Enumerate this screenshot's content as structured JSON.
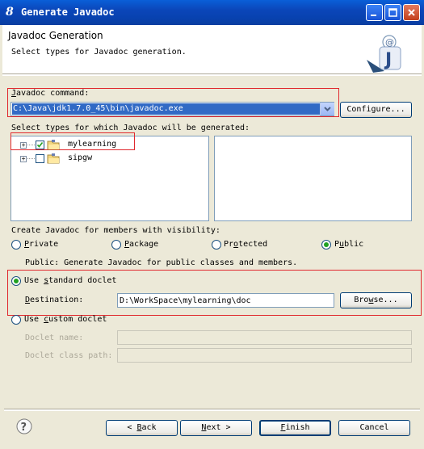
{
  "window": {
    "title": "Generate Javadoc",
    "app_icon": "8"
  },
  "header": {
    "heading": "Javadoc Generation",
    "description": "Select types for Javadoc generation."
  },
  "javadoc_command": {
    "label_mnemonic": "J",
    "label_rest": "avadoc command:",
    "value": "C:\\Java\\jdk1.7.0_45\\bin\\javadoc.exe",
    "configure_label": "Configure..."
  },
  "types": {
    "label": "Select types for which Javadoc will be generated:",
    "items": [
      {
        "name": "mylearning",
        "checked": true
      },
      {
        "name": "sipgw",
        "checked": false
      }
    ]
  },
  "visibility": {
    "label": "Create Javadoc for members with visibility:",
    "options": [
      {
        "m": "",
        "label": "Private",
        "pre": "",
        "rest": "Private",
        "selected": false
      },
      {
        "pre": "",
        "m": "P",
        "rest": "ackage",
        "selected": false
      },
      {
        "pre": "Pr",
        "m": "o",
        "rest": "tected",
        "selected": false
      },
      {
        "pre": "P",
        "m": "u",
        "rest": "blic",
        "selected": true
      }
    ],
    "description": "Public: Generate Javadoc for public classes and members."
  },
  "standard_doclet": {
    "pre": "Use ",
    "m": "s",
    "rest": "tandard doclet",
    "selected": true,
    "destination_pre": "",
    "destination_m": "D",
    "destination_rest": "estination:",
    "destination_value": "D:\\WorkSpace\\mylearning\\doc",
    "browse_pre": "Bro",
    "browse_m": "w",
    "browse_rest": "se..."
  },
  "custom_doclet": {
    "pre": "Use ",
    "m": "c",
    "rest": "ustom doclet",
    "selected": false,
    "name_label": "Doclet name:",
    "classpath_label": "Doclet class path:"
  },
  "footer": {
    "back_pre": "< ",
    "back_m": "B",
    "back_rest": "ack",
    "next_m": "N",
    "next_rest": "ext >",
    "finish_m": "F",
    "finish_rest": "inish",
    "cancel_label": "Cancel"
  },
  "colors": {
    "titlebar": "#0842b0",
    "dialog_bg": "#ece9d8",
    "highlight": "#316ac5",
    "annotation_red": "#e0282d"
  }
}
